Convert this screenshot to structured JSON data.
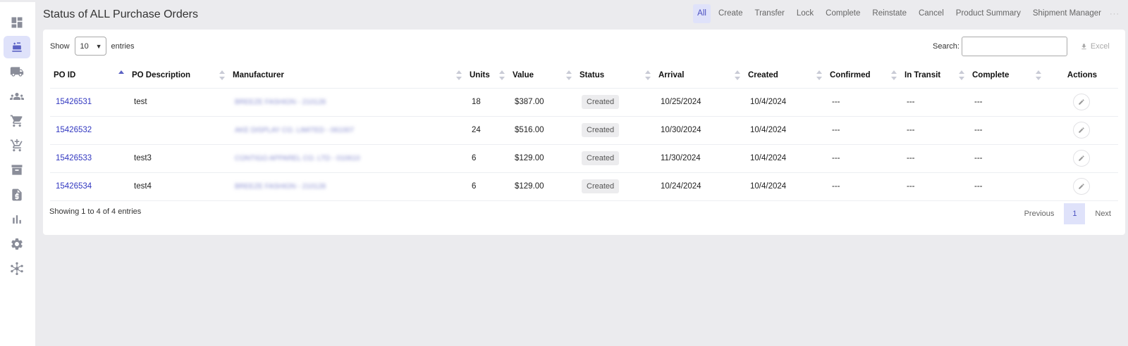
{
  "page": {
    "title": "Status of ALL Purchase Orders"
  },
  "sidebar": {
    "items": [
      {
        "icon": "dashboard-icon"
      },
      {
        "icon": "purchase-orders-icon",
        "active": true
      },
      {
        "icon": "truck-icon"
      },
      {
        "icon": "people-icon"
      },
      {
        "icon": "cart-icon"
      },
      {
        "icon": "cart-add-icon"
      },
      {
        "icon": "archive-icon"
      },
      {
        "icon": "invoice-dollar-icon"
      },
      {
        "icon": "bar-chart-icon"
      },
      {
        "icon": "gear-icon"
      },
      {
        "icon": "network-icon"
      }
    ]
  },
  "topnav": {
    "items": [
      "All",
      "Create",
      "Transfer",
      "Lock",
      "Complete",
      "Reinstate",
      "Cancel",
      "Product Summary",
      "Shipment Manager"
    ],
    "active": "All",
    "more": "···"
  },
  "controls": {
    "show_label": "Show",
    "entries_value": "10",
    "entries_label": "entries",
    "search_label": "Search:",
    "search_value": "",
    "excel_label": "Excel"
  },
  "table": {
    "headers": [
      "PO ID",
      "PO Description",
      "Manufacturer",
      "Units",
      "Value",
      "Status",
      "Arrival",
      "Created",
      "Confirmed",
      "In Transit",
      "Complete",
      "Actions"
    ],
    "rows": [
      {
        "po_id": "15426531",
        "description": "test",
        "manufacturer": "BREEZE FASHION - 210128",
        "units": "18",
        "value": "$387.00",
        "status": "Created",
        "arrival": "10/25/2024",
        "created": "10/4/2024",
        "confirmed": "---",
        "in_transit": "---",
        "complete": "---"
      },
      {
        "po_id": "15426532",
        "description": "",
        "manufacturer": "AKE DISPLAY CO. LIMITED - 061007",
        "units": "24",
        "value": "$516.00",
        "status": "Created",
        "arrival": "10/30/2024",
        "created": "10/4/2024",
        "confirmed": "---",
        "in_transit": "---",
        "complete": "---"
      },
      {
        "po_id": "15426533",
        "description": "test3",
        "manufacturer": "CONTIGO APPAREL CO. LTD - 010610",
        "units": "6",
        "value": "$129.00",
        "status": "Created",
        "arrival": "11/30/2024",
        "created": "10/4/2024",
        "confirmed": "---",
        "in_transit": "---",
        "complete": "---"
      },
      {
        "po_id": "15426534",
        "description": "test4",
        "manufacturer": "BREEZE FASHION - 210128",
        "units": "6",
        "value": "$129.00",
        "status": "Created",
        "arrival": "10/24/2024",
        "created": "10/4/2024",
        "confirmed": "---",
        "in_transit": "---",
        "complete": "---"
      }
    ]
  },
  "footer": {
    "info": "Showing 1 to 4 of 4 entries",
    "previous": "Previous",
    "page": "1",
    "next": "Next"
  }
}
